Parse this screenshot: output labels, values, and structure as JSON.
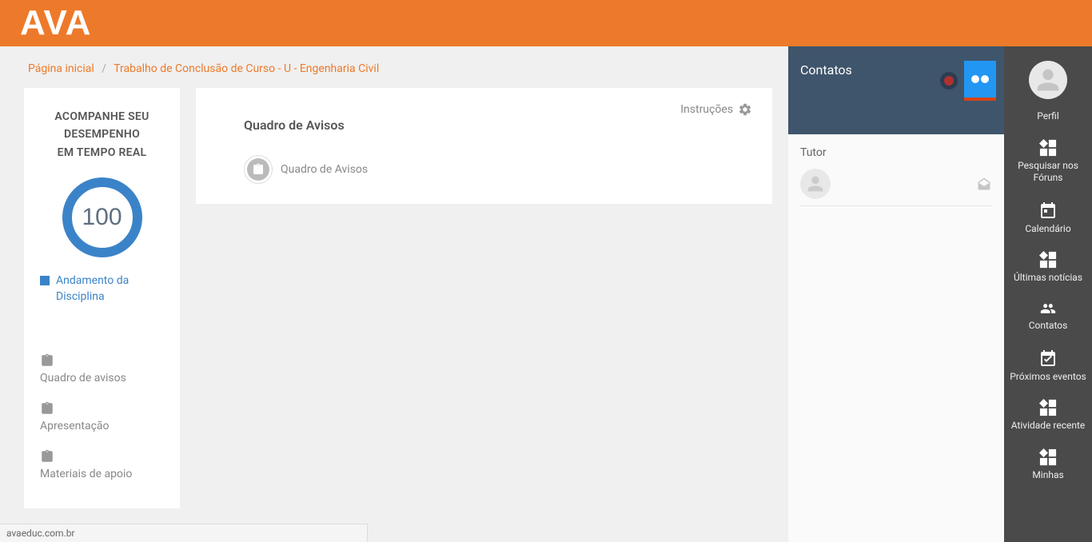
{
  "logo": "AVA",
  "breadcrumb": {
    "home": "Página inicial",
    "course": "Trabalho de Conclusão de Curso - U - Engenharia Civil"
  },
  "progress_card": {
    "title_l1": "ACOMPANHE SEU",
    "title_l2": "DESEMPENHO",
    "title_l3": "EM TEMPO REAL",
    "value": "100",
    "legend": "Andamento da Disciplina",
    "nav1": "Quadro de avisos",
    "nav2": "Apresentação",
    "nav3": "Materiais de apoio"
  },
  "main": {
    "instructions": "Instruções",
    "heading": "Quadro de Avisos",
    "item1": "Quadro de Avisos"
  },
  "contacts": {
    "title": "Contatos",
    "tutor_label": "Tutor"
  },
  "right_sidebar": {
    "perfil": "Perfil",
    "pesquisar": "Pesquisar nos Fóruns",
    "calendario": "Calendário",
    "ultimas": "Últimas notícias",
    "contatos": "Contatos",
    "proximos": "Próximos eventos",
    "atividade": "Atividade recente",
    "minhas": "Minhas"
  },
  "status": "avaeduc.com.br"
}
